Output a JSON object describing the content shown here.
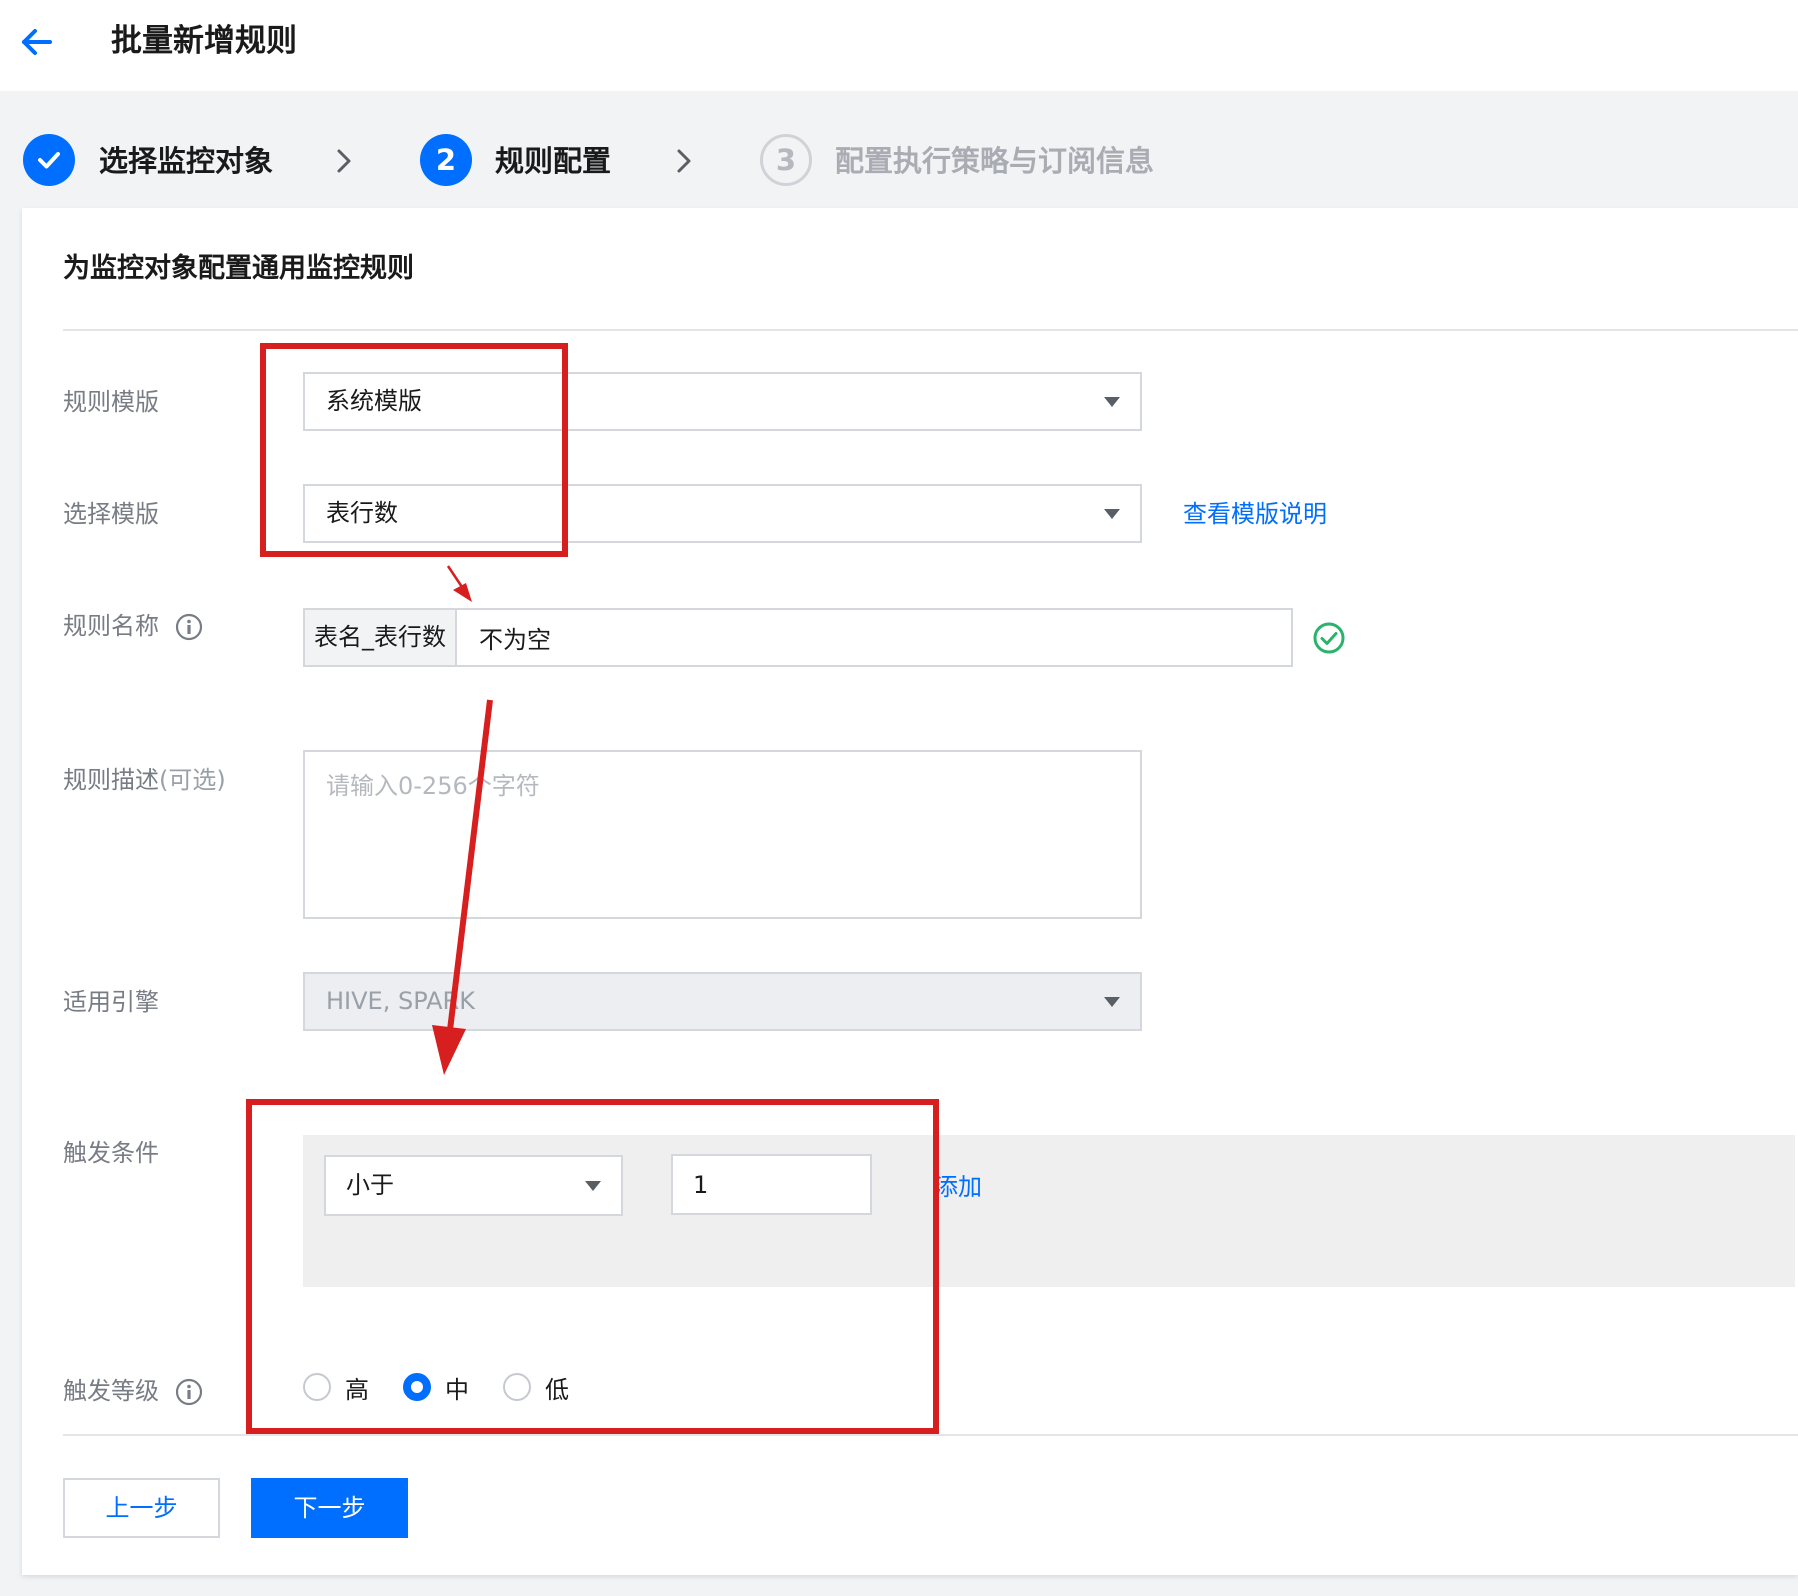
{
  "header": {
    "title": "批量新增规则"
  },
  "steps": [
    {
      "label": "选择监控对象",
      "state": "done"
    },
    {
      "number": "2",
      "label": "规则配置",
      "state": "active"
    },
    {
      "number": "3",
      "label": "配置执行策略与订阅信息",
      "state": "pending"
    }
  ],
  "section": {
    "title": "为监控对象配置通用监控规则"
  },
  "form": {
    "rule_template": {
      "label": "规则模版",
      "value": "系统模版"
    },
    "select_template": {
      "label": "选择模版",
      "value": "表行数",
      "link": "查看模版说明"
    },
    "rule_name": {
      "label": "规则名称",
      "prefix": "表名_表行数",
      "value": "不为空"
    },
    "rule_desc": {
      "label": "规则描述",
      "optional": "(可选)",
      "placeholder": "请输入0-256个字符"
    },
    "engine": {
      "label": "适用引擎",
      "value": "HIVE, SPARK"
    },
    "trigger_condition": {
      "label": "触发条件",
      "operator": "小于",
      "threshold": "1",
      "add_link": "添加"
    },
    "trigger_level": {
      "label": "触发等级",
      "options": [
        "高",
        "中",
        "低"
      ],
      "selected": "中"
    }
  },
  "buttons": {
    "prev": "上一步",
    "next": "下一步"
  },
  "colors": {
    "accent": "#006eff",
    "annotation": "#d71f1f",
    "success": "#29b36b"
  }
}
